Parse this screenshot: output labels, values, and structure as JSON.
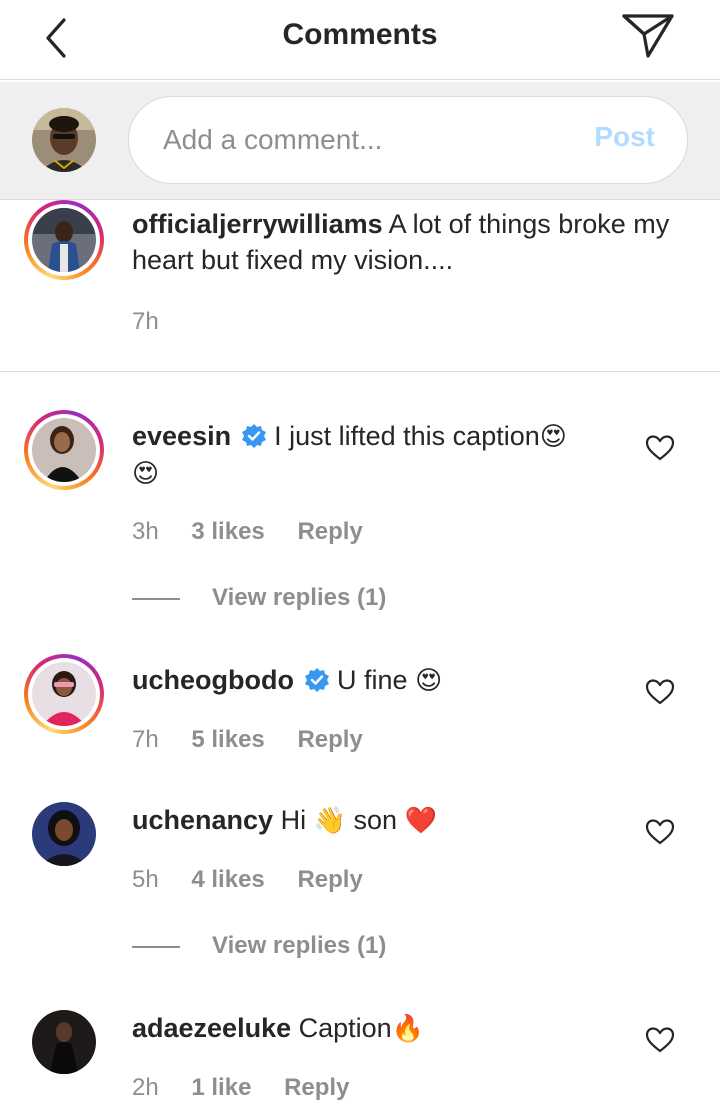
{
  "header": {
    "title": "Comments",
    "back_icon": "chevron-left-icon",
    "send_icon": "paper-plane-icon"
  },
  "composer": {
    "placeholder": "Add a comment...",
    "post_label": "Post",
    "post_color": "#b3dbff"
  },
  "caption": {
    "username": "officialjerrywilliams",
    "text": "A lot of things broke my heart but fixed my vision....",
    "time": "7h"
  },
  "comments": [
    {
      "username": "eveesin",
      "verified": true,
      "text": "I just lifted this caption",
      "emoji": "😍",
      "emoji2": "😍",
      "time": "3h",
      "likes": "3 likes",
      "reply": "Reply",
      "view_replies": "View replies (1)"
    },
    {
      "username": "ucheogbodo",
      "verified": true,
      "text": "U fine",
      "emoji": "😍",
      "time": "7h",
      "likes": "5 likes",
      "reply": "Reply"
    },
    {
      "username": "uchenancy",
      "verified": false,
      "text": "Hi",
      "emoji": "👋",
      "text2": "son",
      "emoji2": "❤️",
      "time": "5h",
      "likes": "4 likes",
      "reply": "Reply",
      "view_replies": "View replies (1)"
    },
    {
      "username": "adaezeeluke",
      "verified": false,
      "text": "Caption",
      "emoji": "🔥",
      "time": "2h",
      "likes": "1 like",
      "reply": "Reply"
    }
  ],
  "colors": {
    "text": "#262626",
    "muted": "#8e8e8e",
    "verified_blue": "#3897f0",
    "heart_red": "#ed4956"
  }
}
